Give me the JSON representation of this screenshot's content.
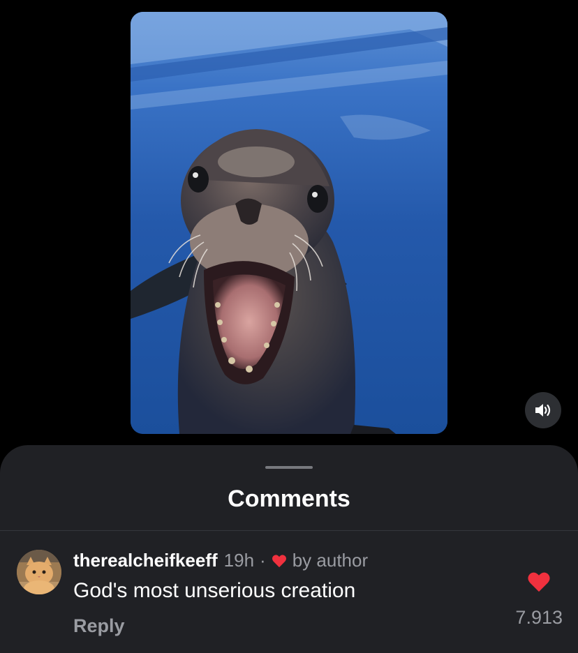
{
  "media": {
    "description_icon": "video-frame",
    "volume_icon": "speaker-icon"
  },
  "sheet": {
    "title": "Comments"
  },
  "comment": {
    "username": "therealcheifkeeff",
    "timestamp": "19h",
    "separator": "·",
    "author_badge_icon": "heart-icon",
    "author_badge_text": "by author",
    "text": "God's most unserious creation",
    "reply_label": "Reply",
    "like_icon": "heart-icon",
    "like_count": "7.913"
  },
  "colors": {
    "background": "#000000",
    "sheet": "#202125",
    "accent_heart": "#f0313e",
    "muted_text": "#9a9ca2"
  }
}
